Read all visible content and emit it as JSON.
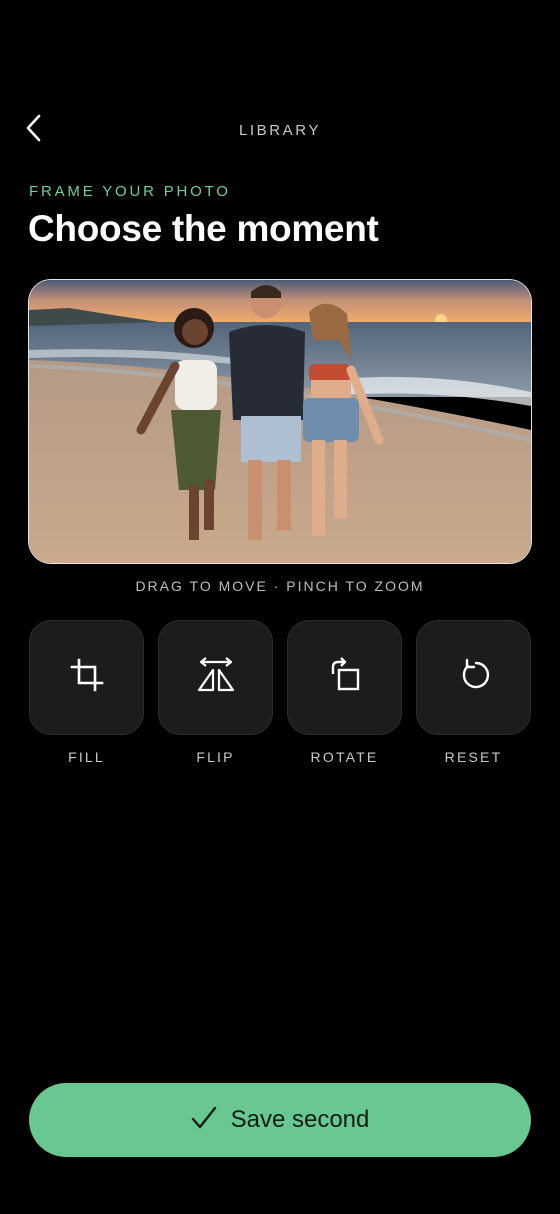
{
  "nav": {
    "title": "LIBRARY"
  },
  "header": {
    "eyebrow": "FRAME YOUR PHOTO",
    "title": "Choose the moment"
  },
  "photo": {
    "hint": "DRAG TO MOVE · PINCH TO ZOOM"
  },
  "tools": [
    {
      "label": "FILL",
      "icon": "crop-icon"
    },
    {
      "label": "FLIP",
      "icon": "flip-icon"
    },
    {
      "label": "ROTATE",
      "icon": "rotate-icon"
    },
    {
      "label": "RESET",
      "icon": "reset-icon"
    }
  ],
  "footer": {
    "save_label": "Save second"
  },
  "colors": {
    "accent": "#69c792",
    "eyebrow": "#6fcf97",
    "background": "#000000",
    "tile": "#1c1c1e"
  }
}
